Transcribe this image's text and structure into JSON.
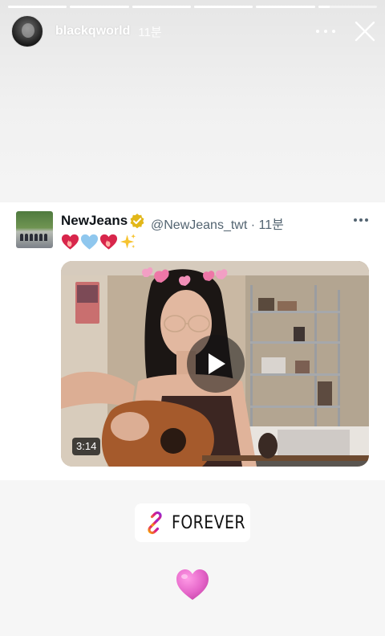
{
  "story": {
    "progress": [
      1,
      1,
      1,
      1,
      1,
      0.2
    ],
    "username": "blackqworld",
    "time": "11분",
    "menu_icon": "more-horizontal-icon",
    "close_icon": "close-icon"
  },
  "tweet": {
    "name": "NewJeans",
    "handle": "@NewJeans_twt · 11분",
    "emojis": [
      "heart-on-fire",
      "light-blue-heart",
      "heart-on-fire",
      "sparkles"
    ],
    "video": {
      "duration": "3:14"
    }
  },
  "sticker": {
    "label": "FOREVER",
    "icon": "link-icon"
  },
  "bottom_emoji": "pink-heart",
  "colors": {
    "verified_gold": "#e2b719",
    "link_gradient": [
      "#f7a400",
      "#e21a7a",
      "#8d2ad8"
    ],
    "pink_heart": "#e566c9"
  }
}
